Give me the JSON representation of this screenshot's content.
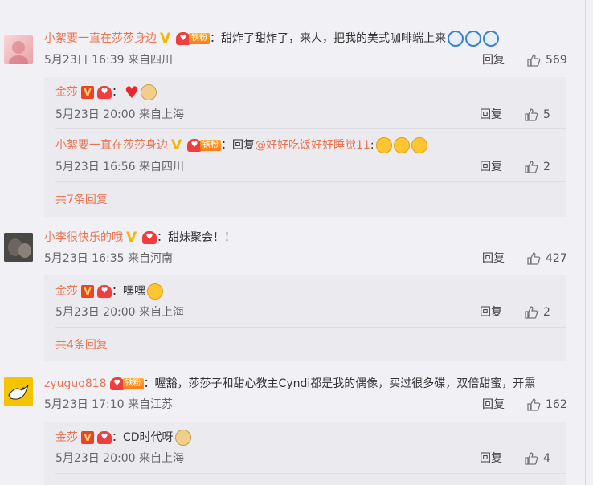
{
  "comments": [
    {
      "name": "小絮要一直在莎莎身边",
      "fan_tag": "铁粉",
      "text": "：甜炸了甜炸了，来人，把我的美式咖啡端上来",
      "time": "5月23日 16:39 来自四川",
      "reply_label": "回复",
      "likes": "569",
      "replies": [
        {
          "name": "金莎",
          "text": "：",
          "time": "5月23日 20:00 来自上海",
          "reply_label": "回复",
          "likes": "5"
        },
        {
          "name": "小絮要一直在莎莎身边",
          "fan_tag": "铁粉",
          "reply_prefix": "：回复",
          "mention": "@好好吃饭好好睡觉11",
          "text": ":",
          "time": "5月23日 16:56 来自四川",
          "reply_label": "回复",
          "likes": "2"
        }
      ],
      "more": "共7条回复"
    },
    {
      "name": "小李很快乐的哦",
      "text": "：甜妹聚会！！",
      "time": "5月23日 16:35 来自河南",
      "reply_label": "回复",
      "likes": "427",
      "replies": [
        {
          "name": "金莎",
          "text": "：嘿嘿",
          "time": "5月23日 20:00 来自上海",
          "reply_label": "回复",
          "likes": "2"
        }
      ],
      "more": "共4条回复"
    },
    {
      "name": "zyuguo818",
      "fan_tag": "铁粉",
      "text": "：喔豁，莎莎子和甜心教主Cyndi都是我的偶像，买过很多碟，双倍甜蜜，开熏",
      "time": "5月23日 17:10 来自江苏",
      "reply_label": "回复",
      "likes": "162",
      "replies": [
        {
          "name": "金莎",
          "text": "：CD时代呀",
          "time": "5月23日 20:00 来自上海",
          "reply_label": "回复",
          "likes": "4"
        }
      ]
    }
  ],
  "badge_v": "V",
  "colors": {
    "accent": "#eb7350",
    "background": "#f1f1f5",
    "subbox": "#ebebef"
  }
}
